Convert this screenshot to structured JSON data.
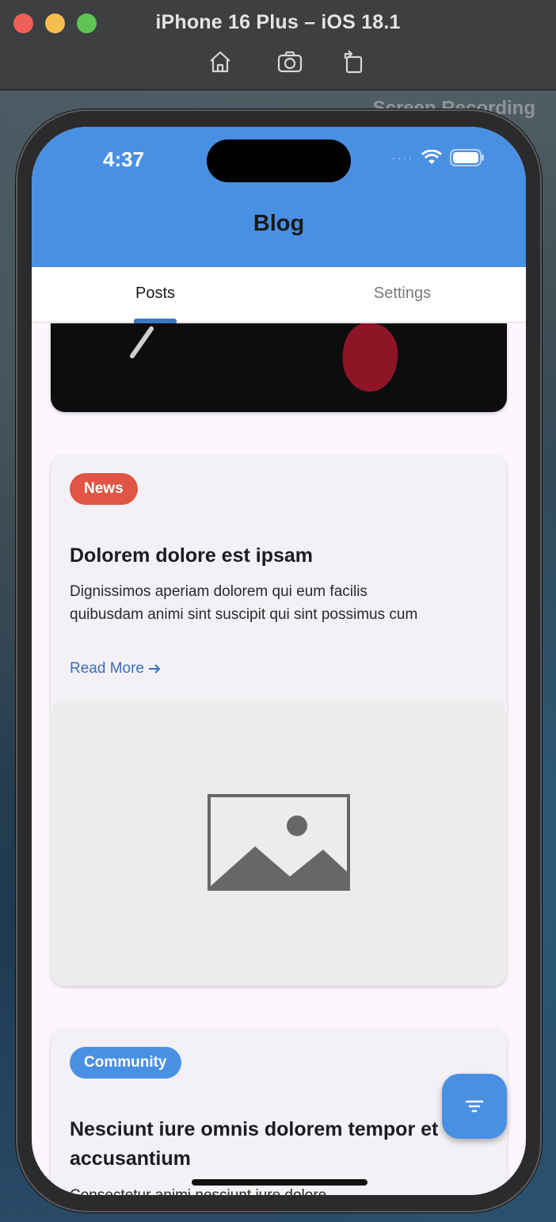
{
  "simulator": {
    "title": "iPhone 16 Plus – iOS 18.1",
    "toolbar": [
      "home-icon",
      "screenshot-icon",
      "rotate-icon"
    ],
    "background_label": "Screen Recording"
  },
  "status_bar": {
    "time": "4:37"
  },
  "app_bar": {
    "title": "Blog",
    "color": "#4a90e2"
  },
  "tabs": [
    {
      "label": "Posts",
      "active": true
    },
    {
      "label": "Settings",
      "active": false
    }
  ],
  "posts": [
    {
      "category": "News",
      "category_color": "#e05543",
      "title": "Dolorem dolore est ipsam",
      "excerpt": "Dignissimos aperiam dolorem qui eum facilis quibusdam animi sint suscipit qui sint possimus cum",
      "read_more": "Read More",
      "image": "placeholder-image-icon"
    },
    {
      "category": "Community",
      "category_color": "#4a90e2",
      "title": "Nesciunt iure omnis dolorem tempor et accusantium",
      "excerpt": "Consectetur animi nesciunt iure dolore"
    }
  ],
  "fab": {
    "icon": "filter-icon"
  }
}
